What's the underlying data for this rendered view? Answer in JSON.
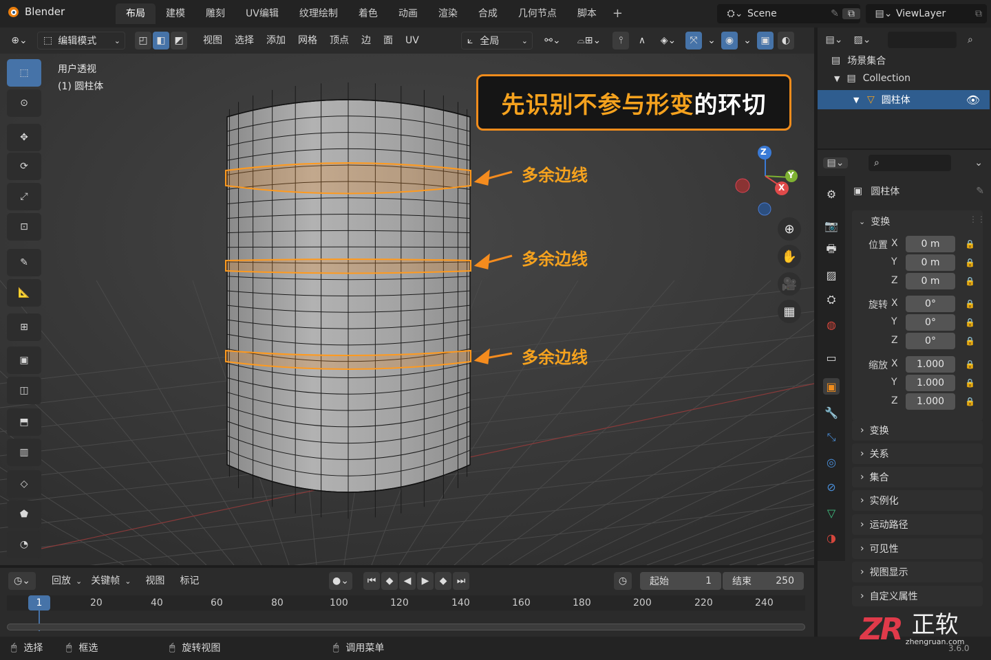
{
  "app": {
    "name": "Blender",
    "version": "3.6.0"
  },
  "workspace_tabs": [
    "布局",
    "建模",
    "雕刻",
    "UV编辑",
    "纹理绘制",
    "着色",
    "动画",
    "渲染",
    "合成",
    "几何节点",
    "脚本"
  ],
  "scene": {
    "name": "Scene",
    "view_layer": "ViewLayer"
  },
  "viewport_header": {
    "mode": "编辑模式",
    "menus": [
      "视图",
      "选择",
      "添加",
      "网格",
      "顶点",
      "边",
      "面",
      "UV"
    ],
    "transform_orientation": "全局"
  },
  "viewport": {
    "view_name": "用户透视",
    "object_label": "(1) 圆柱体",
    "gizmo_axes": [
      "Z",
      "Y",
      "X"
    ],
    "annotation": {
      "orange_text": "先识别不参与形变",
      "white_text": "的环切"
    },
    "callouts": [
      "多余边线",
      "多余边线",
      "多余边线"
    ]
  },
  "outliner": {
    "scene_collection": "场景集合",
    "collection": "Collection",
    "object": "圆柱体"
  },
  "properties": {
    "object_name": "圆柱体",
    "transform_panel": "变换",
    "location_label": "位置",
    "rotation_label": "旋转",
    "scale_label": "缩放",
    "axes": [
      "X",
      "Y",
      "Z"
    ],
    "location": [
      "0 m",
      "0 m",
      "0 m"
    ],
    "rotation": [
      "0°",
      "0°",
      "0°"
    ],
    "scale": [
      "1.000",
      "1.000",
      "1.000"
    ],
    "collapsed_panels": [
      "变换",
      "关系",
      "集合",
      "实例化",
      "运动路径",
      "可见性",
      "视图显示",
      "自定义属性"
    ]
  },
  "timeline": {
    "menus": [
      "回放",
      "关键帧",
      "视图",
      "标记"
    ],
    "start_label": "起始",
    "start": "1",
    "end_label": "结束",
    "end": "250",
    "current_frame": "1",
    "ruler": [
      "20",
      "40",
      "60",
      "80",
      "100",
      "120",
      "140",
      "160",
      "180",
      "200",
      "220",
      "240"
    ]
  },
  "status_bar": {
    "select": "选择",
    "box_select": "框选",
    "rotate_view": "旋转视图",
    "call_menu": "调用菜单"
  },
  "watermark": {
    "brand": "正软",
    "logo": "ZR",
    "url": "zhengruan.com"
  },
  "colors": {
    "accent": "#f08c1c",
    "active_blue": "#4673a8",
    "selected_row": "#2f5d8f"
  }
}
